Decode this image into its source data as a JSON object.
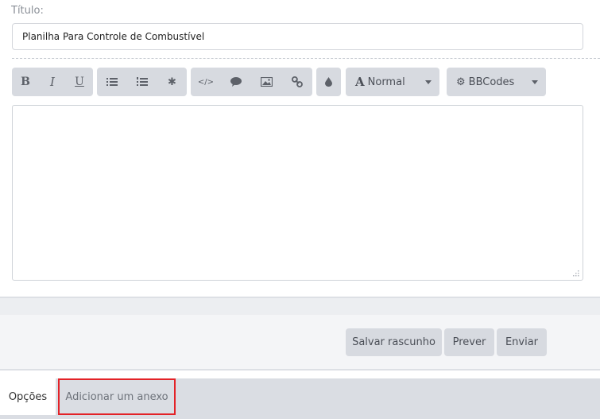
{
  "form": {
    "title_label": "Título:",
    "title_value": "Planilha Para Controle de Combustível"
  },
  "toolbar": {
    "groups": [
      {
        "buttons": [
          {
            "icon": "bold-icon",
            "glyph": "B"
          },
          {
            "icon": "italic-icon",
            "glyph": "I"
          },
          {
            "icon": "underline-icon",
            "glyph": "U"
          }
        ]
      },
      {
        "buttons": [
          {
            "icon": "bullet-list-icon"
          },
          {
            "icon": "numbered-list-icon"
          },
          {
            "icon": "asterisk-icon",
            "glyph": "✱"
          }
        ]
      },
      {
        "buttons": [
          {
            "icon": "code-icon",
            "glyph": "</>"
          },
          {
            "icon": "speech-bubble-icon"
          },
          {
            "icon": "image-icon"
          },
          {
            "icon": "link-icon"
          }
        ]
      },
      {
        "buttons": [
          {
            "icon": "color-drop-icon"
          }
        ]
      }
    ],
    "font_size": {
      "icon_glyph": "A",
      "label": "Normal"
    },
    "bbcodes": {
      "label": "BBCodes"
    }
  },
  "actions": {
    "save_draft": "Salvar rascunho",
    "preview": "Prever",
    "submit": "Enviar"
  },
  "tabs": [
    {
      "label": "Opções",
      "active": true
    },
    {
      "label": "Adicionar um anexo",
      "highlighted": true
    }
  ],
  "colors": {
    "toolbar_bg": "#d7dae0",
    "icon": "#5d6169",
    "highlight_border": "#e32227"
  }
}
